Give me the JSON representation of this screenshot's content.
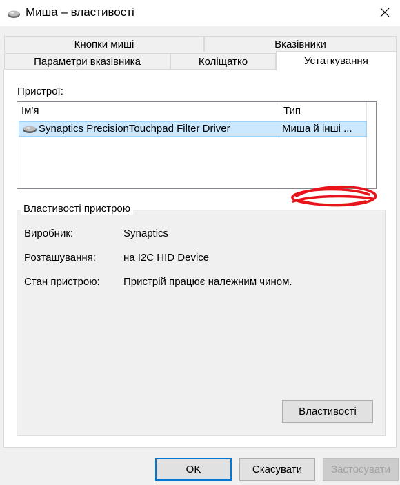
{
  "window": {
    "title": "Миша – властивості",
    "icon": "mouse-icon",
    "close_icon": "close-icon"
  },
  "tabs": {
    "row1": [
      "Кнопки миші",
      "Вказівники"
    ],
    "row2": [
      "Параметри вказівника",
      "Коліщатко",
      "Устаткування"
    ],
    "active": "Устаткування"
  },
  "devices": {
    "label": "Пристрої:",
    "columns": {
      "name": "Ім'я",
      "type": "Тип"
    },
    "rows": [
      {
        "name": "Synaptics PrecisionTouchpad Filter Driver",
        "type": "Миша й інші ...",
        "icon": "mouse-icon",
        "selected": true
      }
    ]
  },
  "device_properties": {
    "group_title": "Властивості пристрою",
    "manufacturer_label": "Виробник:",
    "manufacturer_value": "Synaptics",
    "location_label": "Розташування:",
    "location_value": "на I2C HID Device",
    "status_label": "Стан пристрою:",
    "status_value": "Пристрій працює належним чином.",
    "properties_button": "Властивості"
  },
  "footer": {
    "ok": "OK",
    "cancel": "Скасувати",
    "apply": "Застосувати"
  },
  "annotation": {
    "color": "#e8141c"
  }
}
